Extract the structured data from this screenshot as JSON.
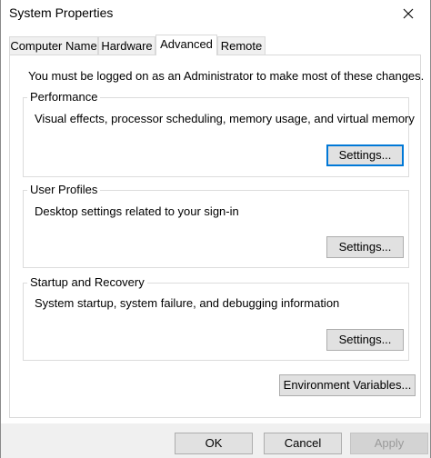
{
  "window": {
    "title": "System Properties"
  },
  "tabs": [
    {
      "label": "Computer Name",
      "active": false
    },
    {
      "label": "Hardware",
      "active": false
    },
    {
      "label": "Advanced",
      "active": true
    },
    {
      "label": "Remote",
      "active": false
    }
  ],
  "advanced": {
    "admin_note": "You must be logged on as an Administrator to make most of these changes.",
    "performance": {
      "title": "Performance",
      "description": "Visual effects, processor scheduling, memory usage, and virtual memory",
      "button_label": "Settings..."
    },
    "user_profiles": {
      "title": "User Profiles",
      "description": "Desktop settings related to your sign-in",
      "button_label": "Settings..."
    },
    "startup_recovery": {
      "title": "Startup and Recovery",
      "description": "System startup, system failure, and debugging information",
      "button_label": "Settings..."
    },
    "env_button_label": "Environment Variables..."
  },
  "footer": {
    "ok_label": "OK",
    "cancel_label": "Cancel",
    "apply_label": "Apply"
  },
  "colors": {
    "focus_border": "#0078d7",
    "highlight_annotation": "#ffff00"
  },
  "icons": {
    "close": "close-icon"
  }
}
